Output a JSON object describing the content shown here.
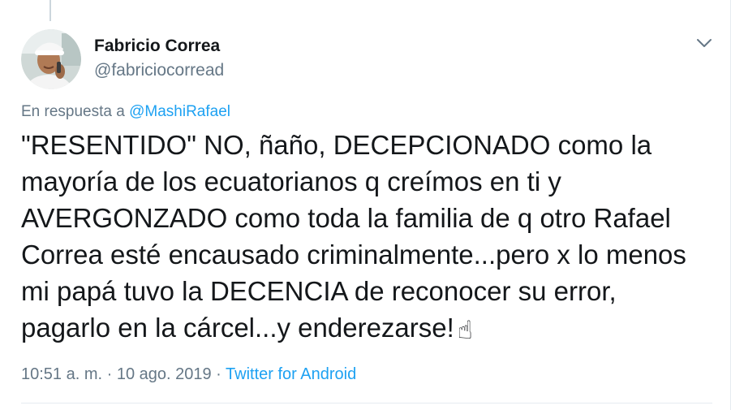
{
  "tweet": {
    "author": {
      "name": "Fabricio Correa",
      "handle": "@fabriciocorread"
    },
    "reply": {
      "prefix": "En respuesta a",
      "mention": "@MashiRafael"
    },
    "text_lines": [
      "\"RESENTIDO\" NO, ñaño, DECEPCIONADO como la",
      "mayoría de los ecuatorianos q creímos en ti y",
      "AVERGONZADO como toda la familia de q otro Rafael",
      "Correa esté encausado criminalmente...pero x lo menos",
      "mi papá tuvo la DECENCIA de reconocer su error,",
      "pagarlo en la cárcel...y enderezarse!"
    ],
    "emoji": "☝",
    "meta": {
      "time": "10:51 a. m.",
      "separator": " · ",
      "date": "10 ago. 2019",
      "source": "Twitter for Android"
    }
  },
  "icons": {
    "caret": "chevron-down-icon",
    "avatar": "avatar"
  },
  "colors": {
    "text": "#14171a",
    "secondary": "#657786",
    "link": "#1da1f2",
    "border": "#e6ecf0"
  }
}
